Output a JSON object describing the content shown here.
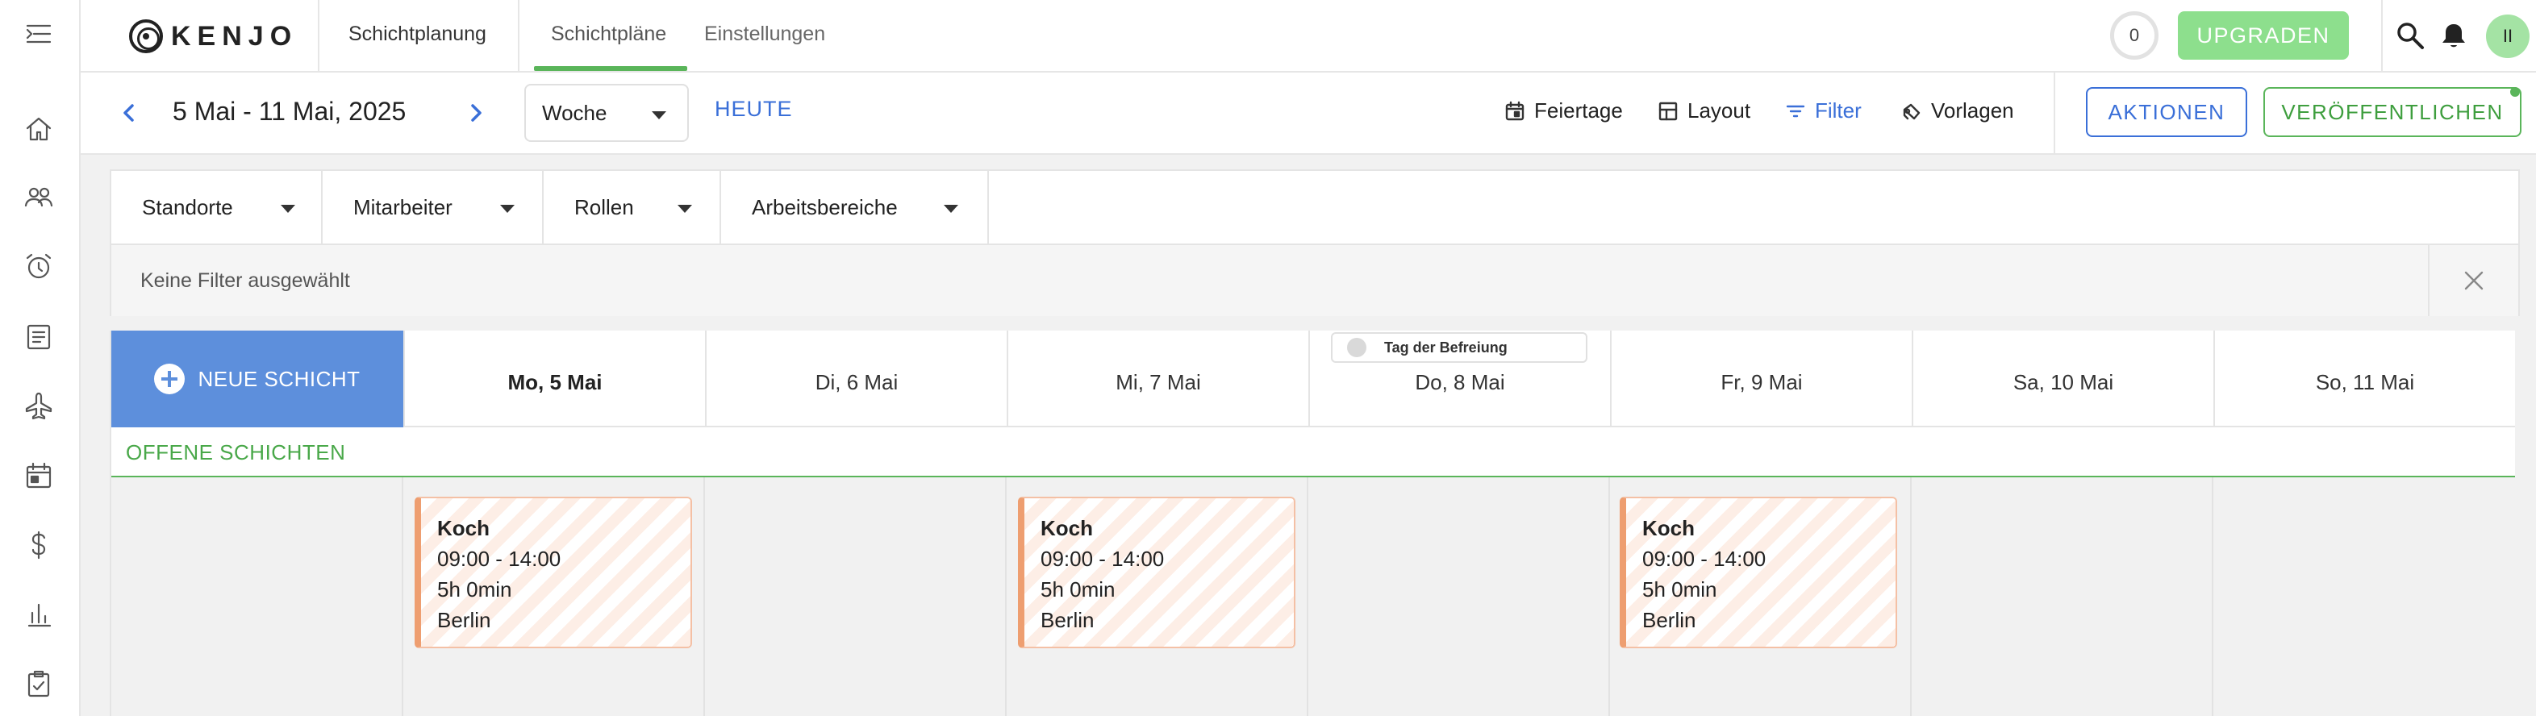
{
  "brand": {
    "name": "KENJO"
  },
  "topbar": {
    "section_title": "Schichtplanung",
    "tabs": [
      {
        "label": "Schichtpläne",
        "active": true
      },
      {
        "label": "Einstellungen",
        "active": false
      }
    ],
    "counter": "0",
    "upgrade_label": "UPGRADEN",
    "avatar_initials": "II"
  },
  "sidebar": {
    "items": [
      "menu-toggle-icon",
      "home-icon",
      "people-icon",
      "alarm-clock-icon",
      "document-icon",
      "airplane-icon",
      "calendar-icon",
      "dollar-icon",
      "bar-chart-icon",
      "task-check-icon"
    ]
  },
  "toolbar": {
    "date_range": "5 Mai - 11 Mai, 2025",
    "view": "Woche",
    "today_label": "HEUTE",
    "holidays_label": "Feiertage",
    "layout_label": "Layout",
    "filter_label": "Filter",
    "templates_label": "Vorlagen",
    "actions_label": "AKTIONEN",
    "publish_label": "VERÖFFENTLICHEN"
  },
  "filters": {
    "dropdowns": [
      "Standorte",
      "Mitarbeiter",
      "Rollen",
      "Arbeitsbereiche"
    ],
    "status": "Keine Filter ausgewählt"
  },
  "schedule": {
    "new_shift_label": "NEUE SCHICHT",
    "holiday": "Tag der Befreiung",
    "days": [
      "Mo, 5 Mai",
      "Di, 6 Mai",
      "Mi, 7 Mai",
      "Do, 8 Mai",
      "Fr, 9 Mai",
      "Sa, 10 Mai",
      "So, 11 Mai"
    ],
    "open_shifts_label": "OFFENE SCHICHTEN",
    "shifts": [
      {
        "day": "Mo, 5 Mai",
        "role": "Koch",
        "time": "09:00 - 14:00",
        "duration": "5h 0min",
        "location": "Berlin"
      },
      {
        "day": "Mi, 7 Mai",
        "role": "Koch",
        "time": "09:00 - 14:00",
        "duration": "5h 0min",
        "location": "Berlin"
      },
      {
        "day": "Fr, 9 Mai",
        "role": "Koch",
        "time": "09:00 - 14:00",
        "duration": "5h 0min",
        "location": "Berlin"
      }
    ]
  },
  "colors": {
    "accent_blue": "#3a6fd8",
    "accent_green": "#5ab55a",
    "new_shift_blue": "#5d8fdc",
    "shift_orange": "#ee9e70"
  }
}
